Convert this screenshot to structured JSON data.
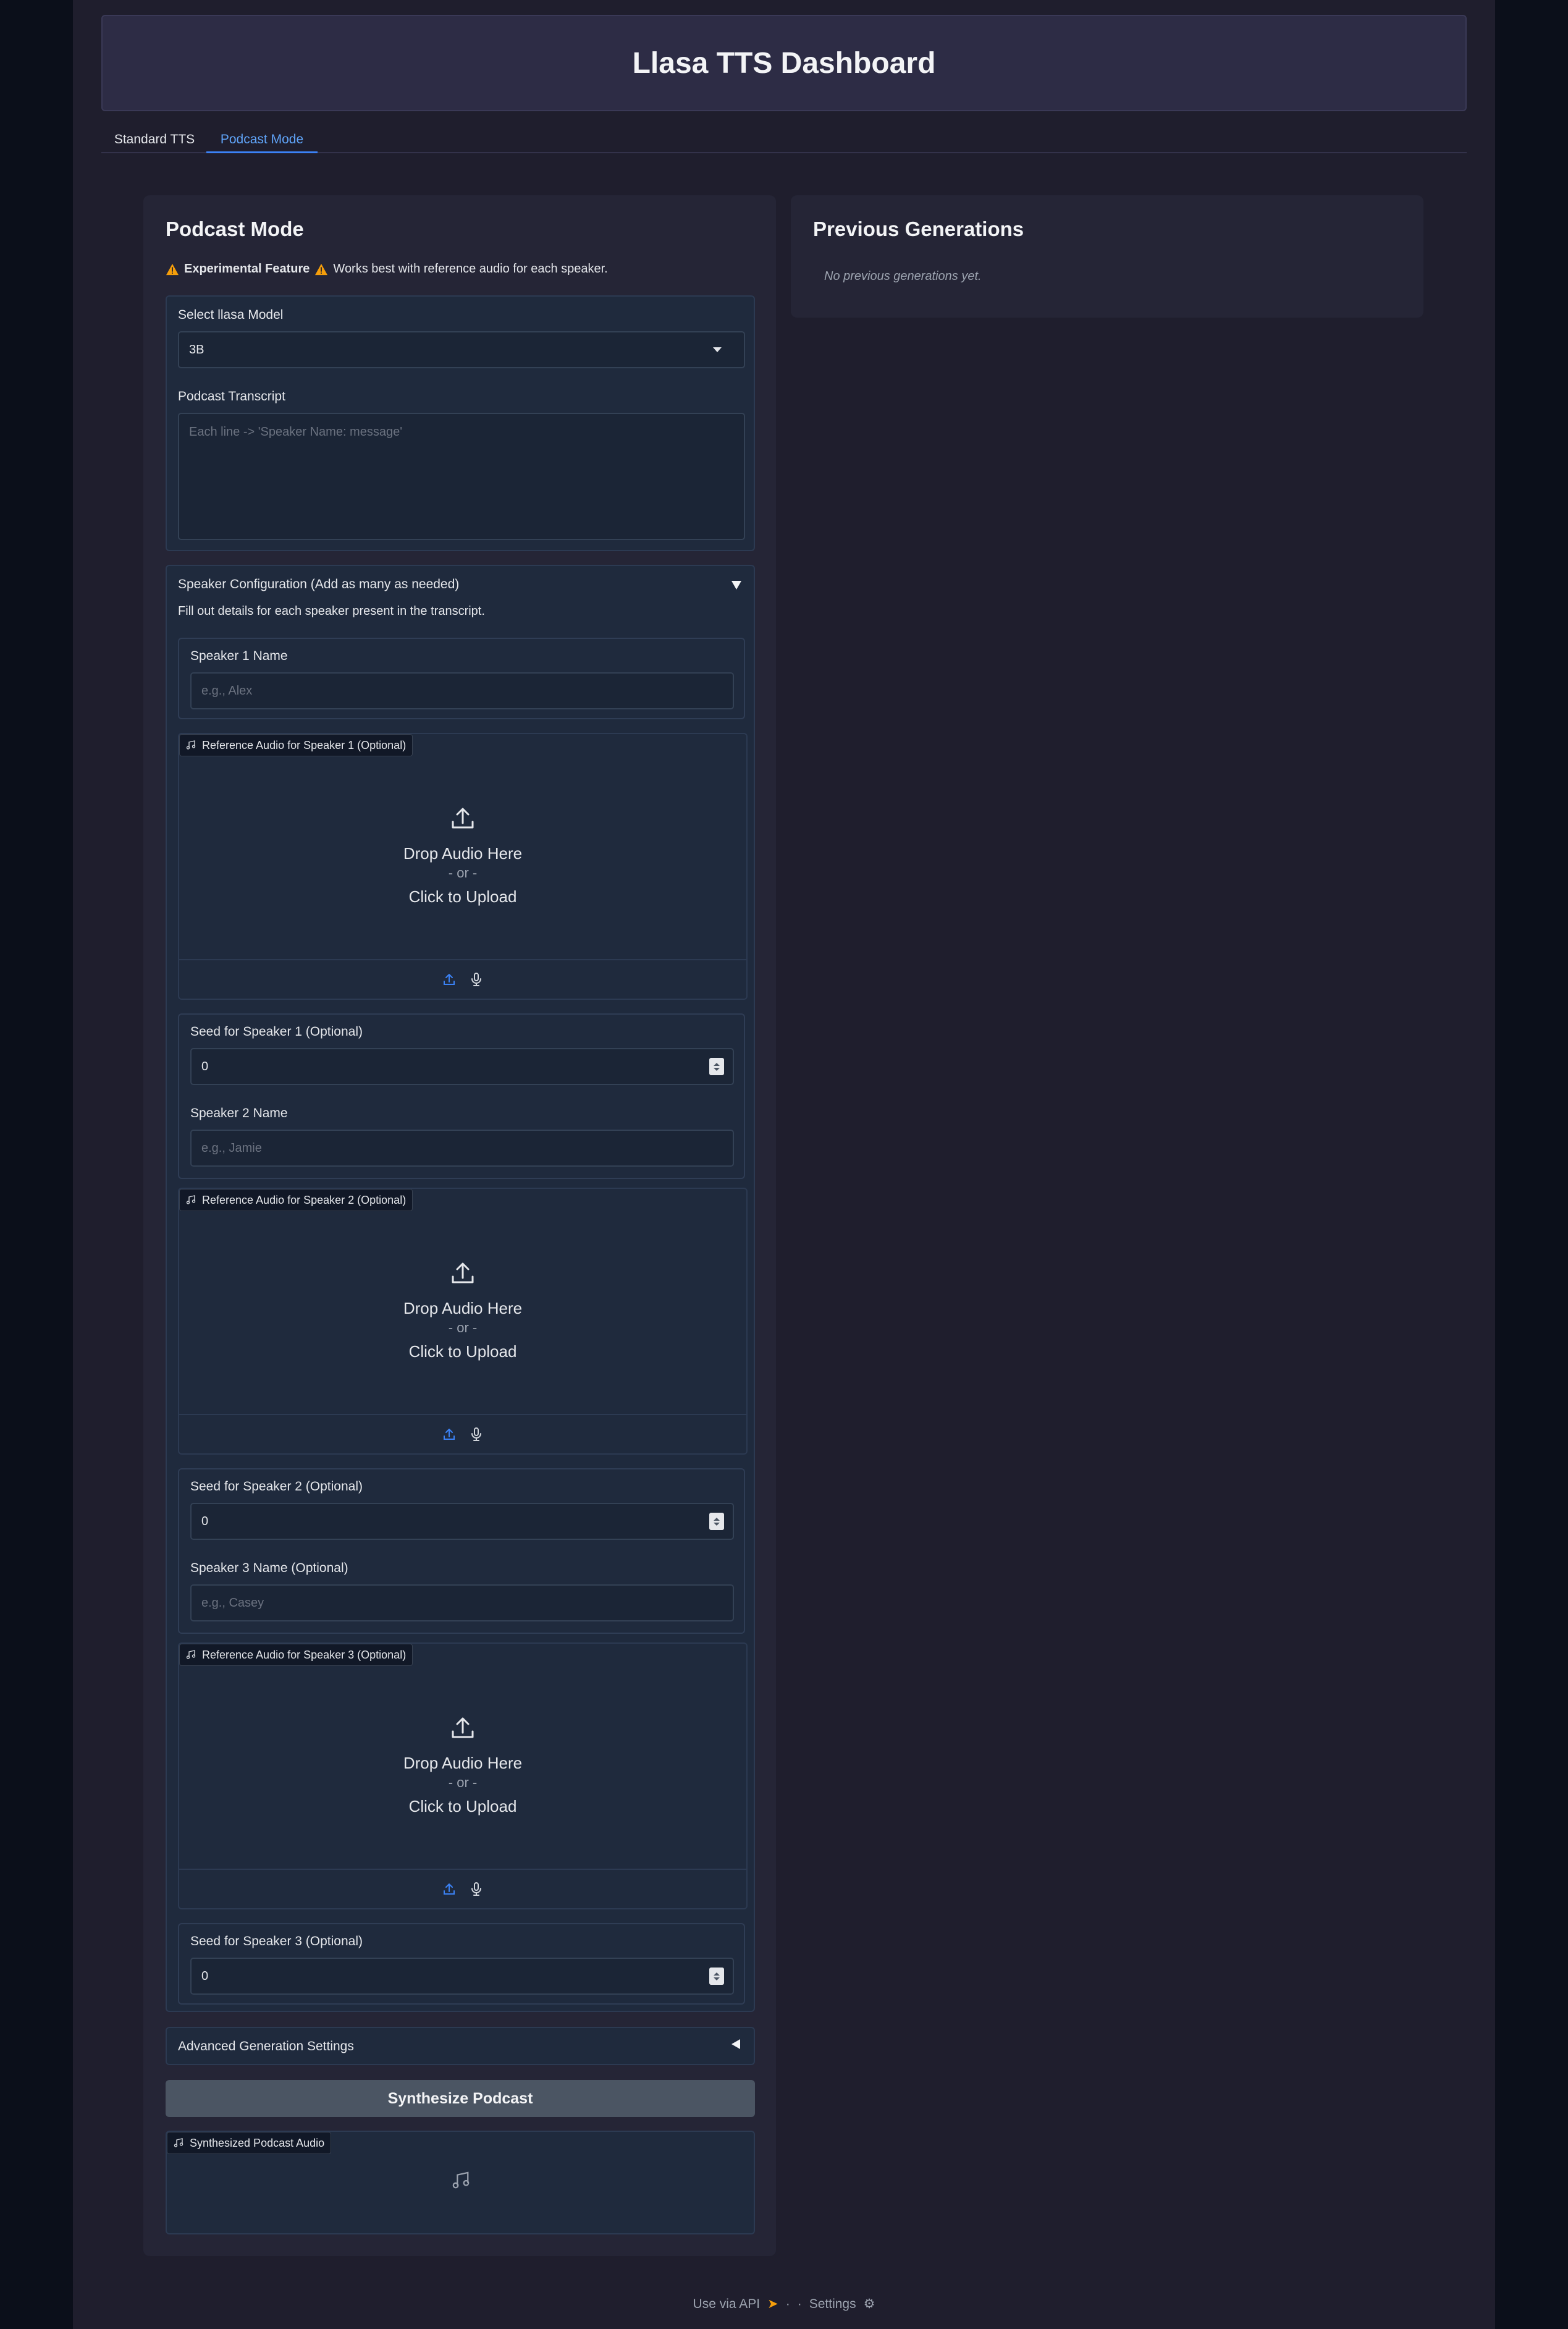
{
  "header": {
    "title": "Llasa TTS Dashboard"
  },
  "tabs": [
    {
      "label": "Standard TTS",
      "active": false
    },
    {
      "label": "Podcast Mode",
      "active": true
    }
  ],
  "podcast": {
    "title": "Podcast Mode",
    "warning_bold": "Experimental Feature",
    "warning_text": "Works best with reference audio for each speaker.",
    "model_label": "Select llasa Model",
    "model_value": "3B",
    "transcript_label": "Podcast Transcript",
    "transcript_placeholder": "Each line -> 'Speaker Name: message'",
    "speaker_config": {
      "title": "Speaker Configuration (Add as many as needed)",
      "description": "Fill out details for each speaker present in the transcript.",
      "speakers": [
        {
          "name_label": "Speaker 1 Name",
          "name_placeholder": "e.g., Alex",
          "audio_label": "Reference Audio for Speaker 1 (Optional)",
          "seed_label": "Seed for Speaker 1 (Optional)",
          "seed_value": "0"
        },
        {
          "name_label": "Speaker 2 Name",
          "name_placeholder": "e.g., Jamie",
          "audio_label": "Reference Audio for Speaker 2 (Optional)",
          "seed_label": "Seed for Speaker 2 (Optional)",
          "seed_value": "0"
        },
        {
          "name_label": "Speaker 3 Name (Optional)",
          "name_placeholder": "e.g., Casey",
          "audio_label": "Reference Audio for Speaker 3 (Optional)",
          "seed_label": "Seed for Speaker 3 (Optional)",
          "seed_value": "0"
        }
      ],
      "drop_line1": "Drop Audio Here",
      "drop_line2": "- or -",
      "drop_line3": "Click to Upload"
    },
    "advanced_label": "Advanced Generation Settings",
    "synthesize_button": "Synthesize Podcast",
    "output_label": "Synthesized Podcast Audio"
  },
  "previous": {
    "title": "Previous Generations",
    "empty_text": "No previous generations yet."
  },
  "footer": {
    "api_label": "Use via API",
    "sep": "·",
    "settings_label": "Settings"
  },
  "colors": {
    "accent": "#3b82f6",
    "warning": "#f59e0b",
    "button": "#4b5563"
  }
}
